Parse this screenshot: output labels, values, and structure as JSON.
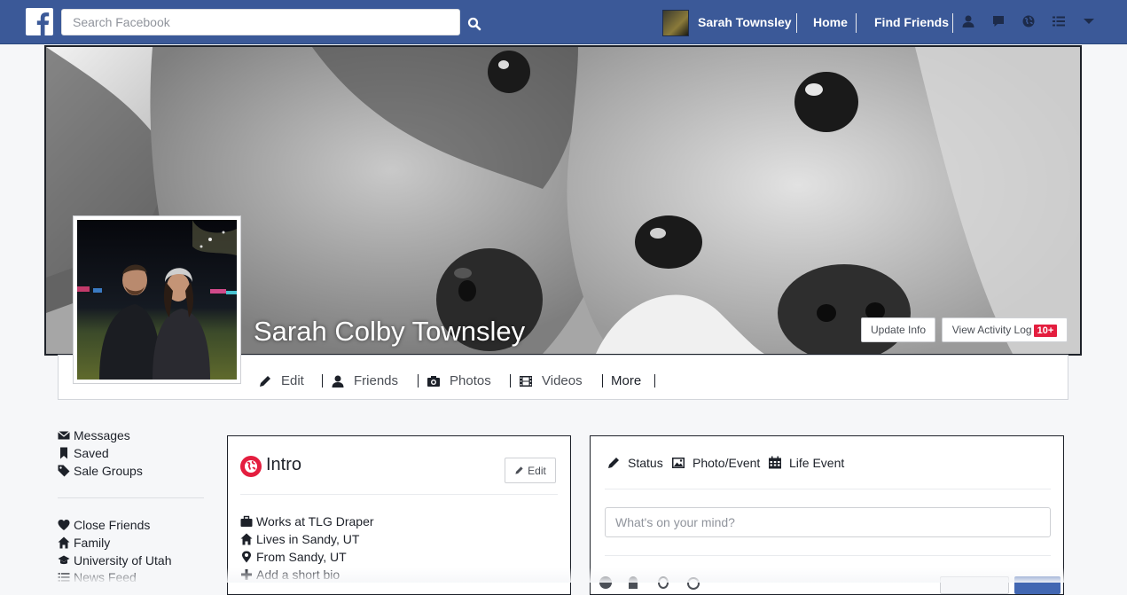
{
  "topbar": {
    "search_placeholder": "Search Facebook",
    "user_name": "Sarah Townsley",
    "home_label": "Home",
    "find_friends_label": "Find Friends",
    "icons": [
      "friend-requests-icon",
      "messages-icon",
      "notifications-globe-icon",
      "list-icon",
      "caret-down-icon"
    ]
  },
  "cover": {
    "name": "Sarah Colby Townsley",
    "update_info_label": "Update Info",
    "activity_log_label": "View Activity Log",
    "activity_badge": "10+"
  },
  "timeline_nav": {
    "edit": "Edit",
    "friends": "Friends",
    "photos": "Photos",
    "videos": "Videos",
    "more": "More"
  },
  "left_menu": {
    "top": [
      {
        "label": "Messages",
        "icon": "envelope-icon"
      },
      {
        "label": "Saved",
        "icon": "bookmark-icon"
      },
      {
        "label": "Sale Groups",
        "icon": "tag-icon"
      }
    ],
    "lists": [
      {
        "label": "Close Friends",
        "icon": "heart-icon"
      },
      {
        "label": "Family",
        "icon": "home-icon"
      },
      {
        "label": "University of Utah",
        "icon": "graduation-cap-icon"
      },
      {
        "label": "News Feed",
        "icon": "list-icon"
      }
    ]
  },
  "intro": {
    "title": "Intro",
    "edit_label": "Edit",
    "rows": [
      {
        "label": "Works at TLG Draper",
        "icon": "briefcase-icon"
      },
      {
        "label": "Lives in Sandy, UT",
        "icon": "home-icon"
      },
      {
        "label": "From Sandy, UT",
        "icon": "map-marker-icon"
      },
      {
        "label": "Add a short bio",
        "icon": "plus-icon"
      }
    ]
  },
  "composer": {
    "status_label": "Status",
    "photo_label": "Photo/Event",
    "life_event_label": "Life Event",
    "placeholder": "What's on your mind?"
  },
  "colors": {
    "brand_blue": "#3b5998",
    "badge_red": "#e41e3f",
    "page_bg": "#f6f7f9"
  }
}
